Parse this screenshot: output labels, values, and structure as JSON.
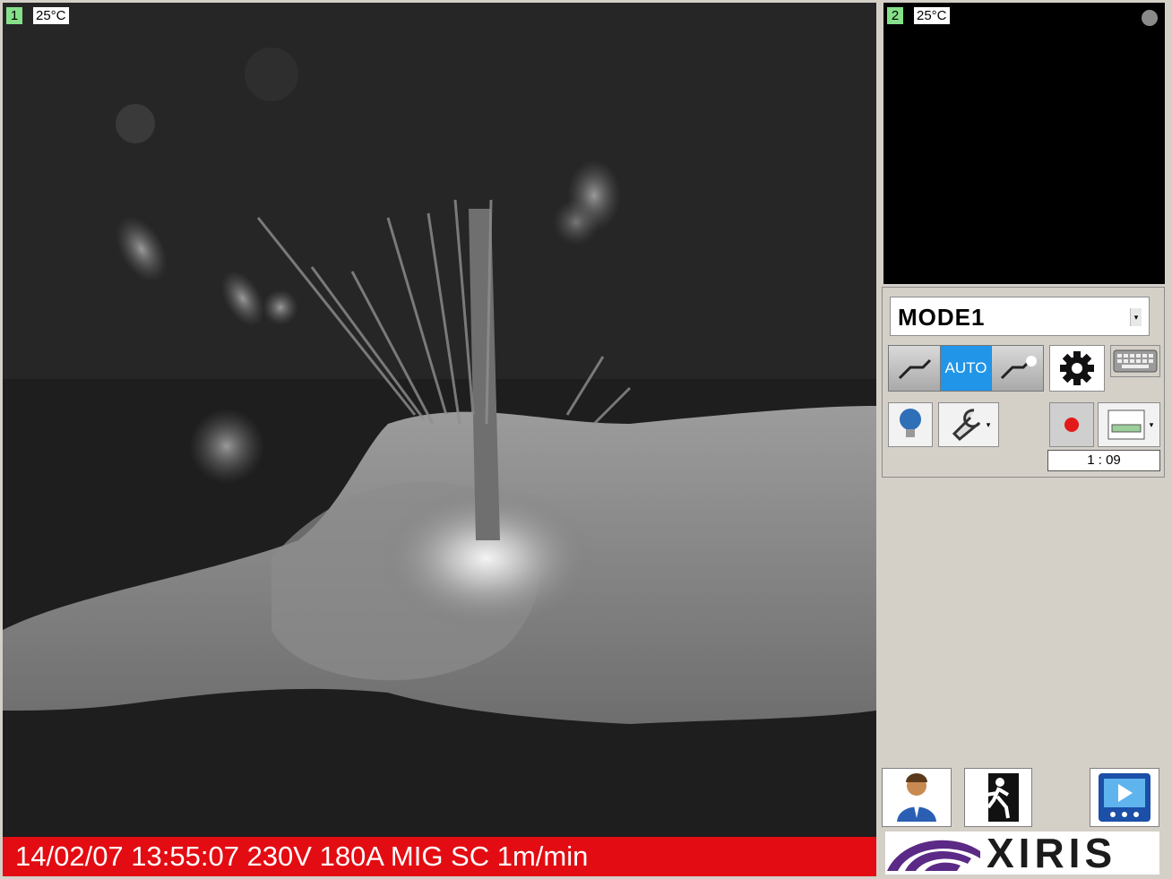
{
  "camera1": {
    "number": "1",
    "temperature": "25°C"
  },
  "camera2": {
    "number": "2",
    "temperature": "25°C"
  },
  "status_bar": {
    "text": "14/02/07 13:55:07 230V 180A MIG SC 1m/min"
  },
  "controls": {
    "mode": {
      "selected": "MODE1"
    },
    "exposure_segment": {
      "auto_label": "AUTO",
      "selected": "AUTO"
    },
    "timer": "1 : 09"
  },
  "logo": {
    "text": "XIRIS"
  },
  "icons": {
    "exposure_low": "torch-low-icon",
    "exposure_high": "torch-arc-icon",
    "settings": "gear-icon",
    "keyboard": "keyboard-icon",
    "lamp": "lightbulb-icon",
    "tools": "wrench-icon",
    "record": "record-icon",
    "storage": "drive-icon",
    "user": "user-icon",
    "exit": "exit-icon",
    "playback": "playback-icon"
  },
  "colors": {
    "status_bar_bg": "#e30c12",
    "auto_active": "#2196e8",
    "camera_tag": "#86e08a",
    "logo_purple": "#5b2a86"
  }
}
